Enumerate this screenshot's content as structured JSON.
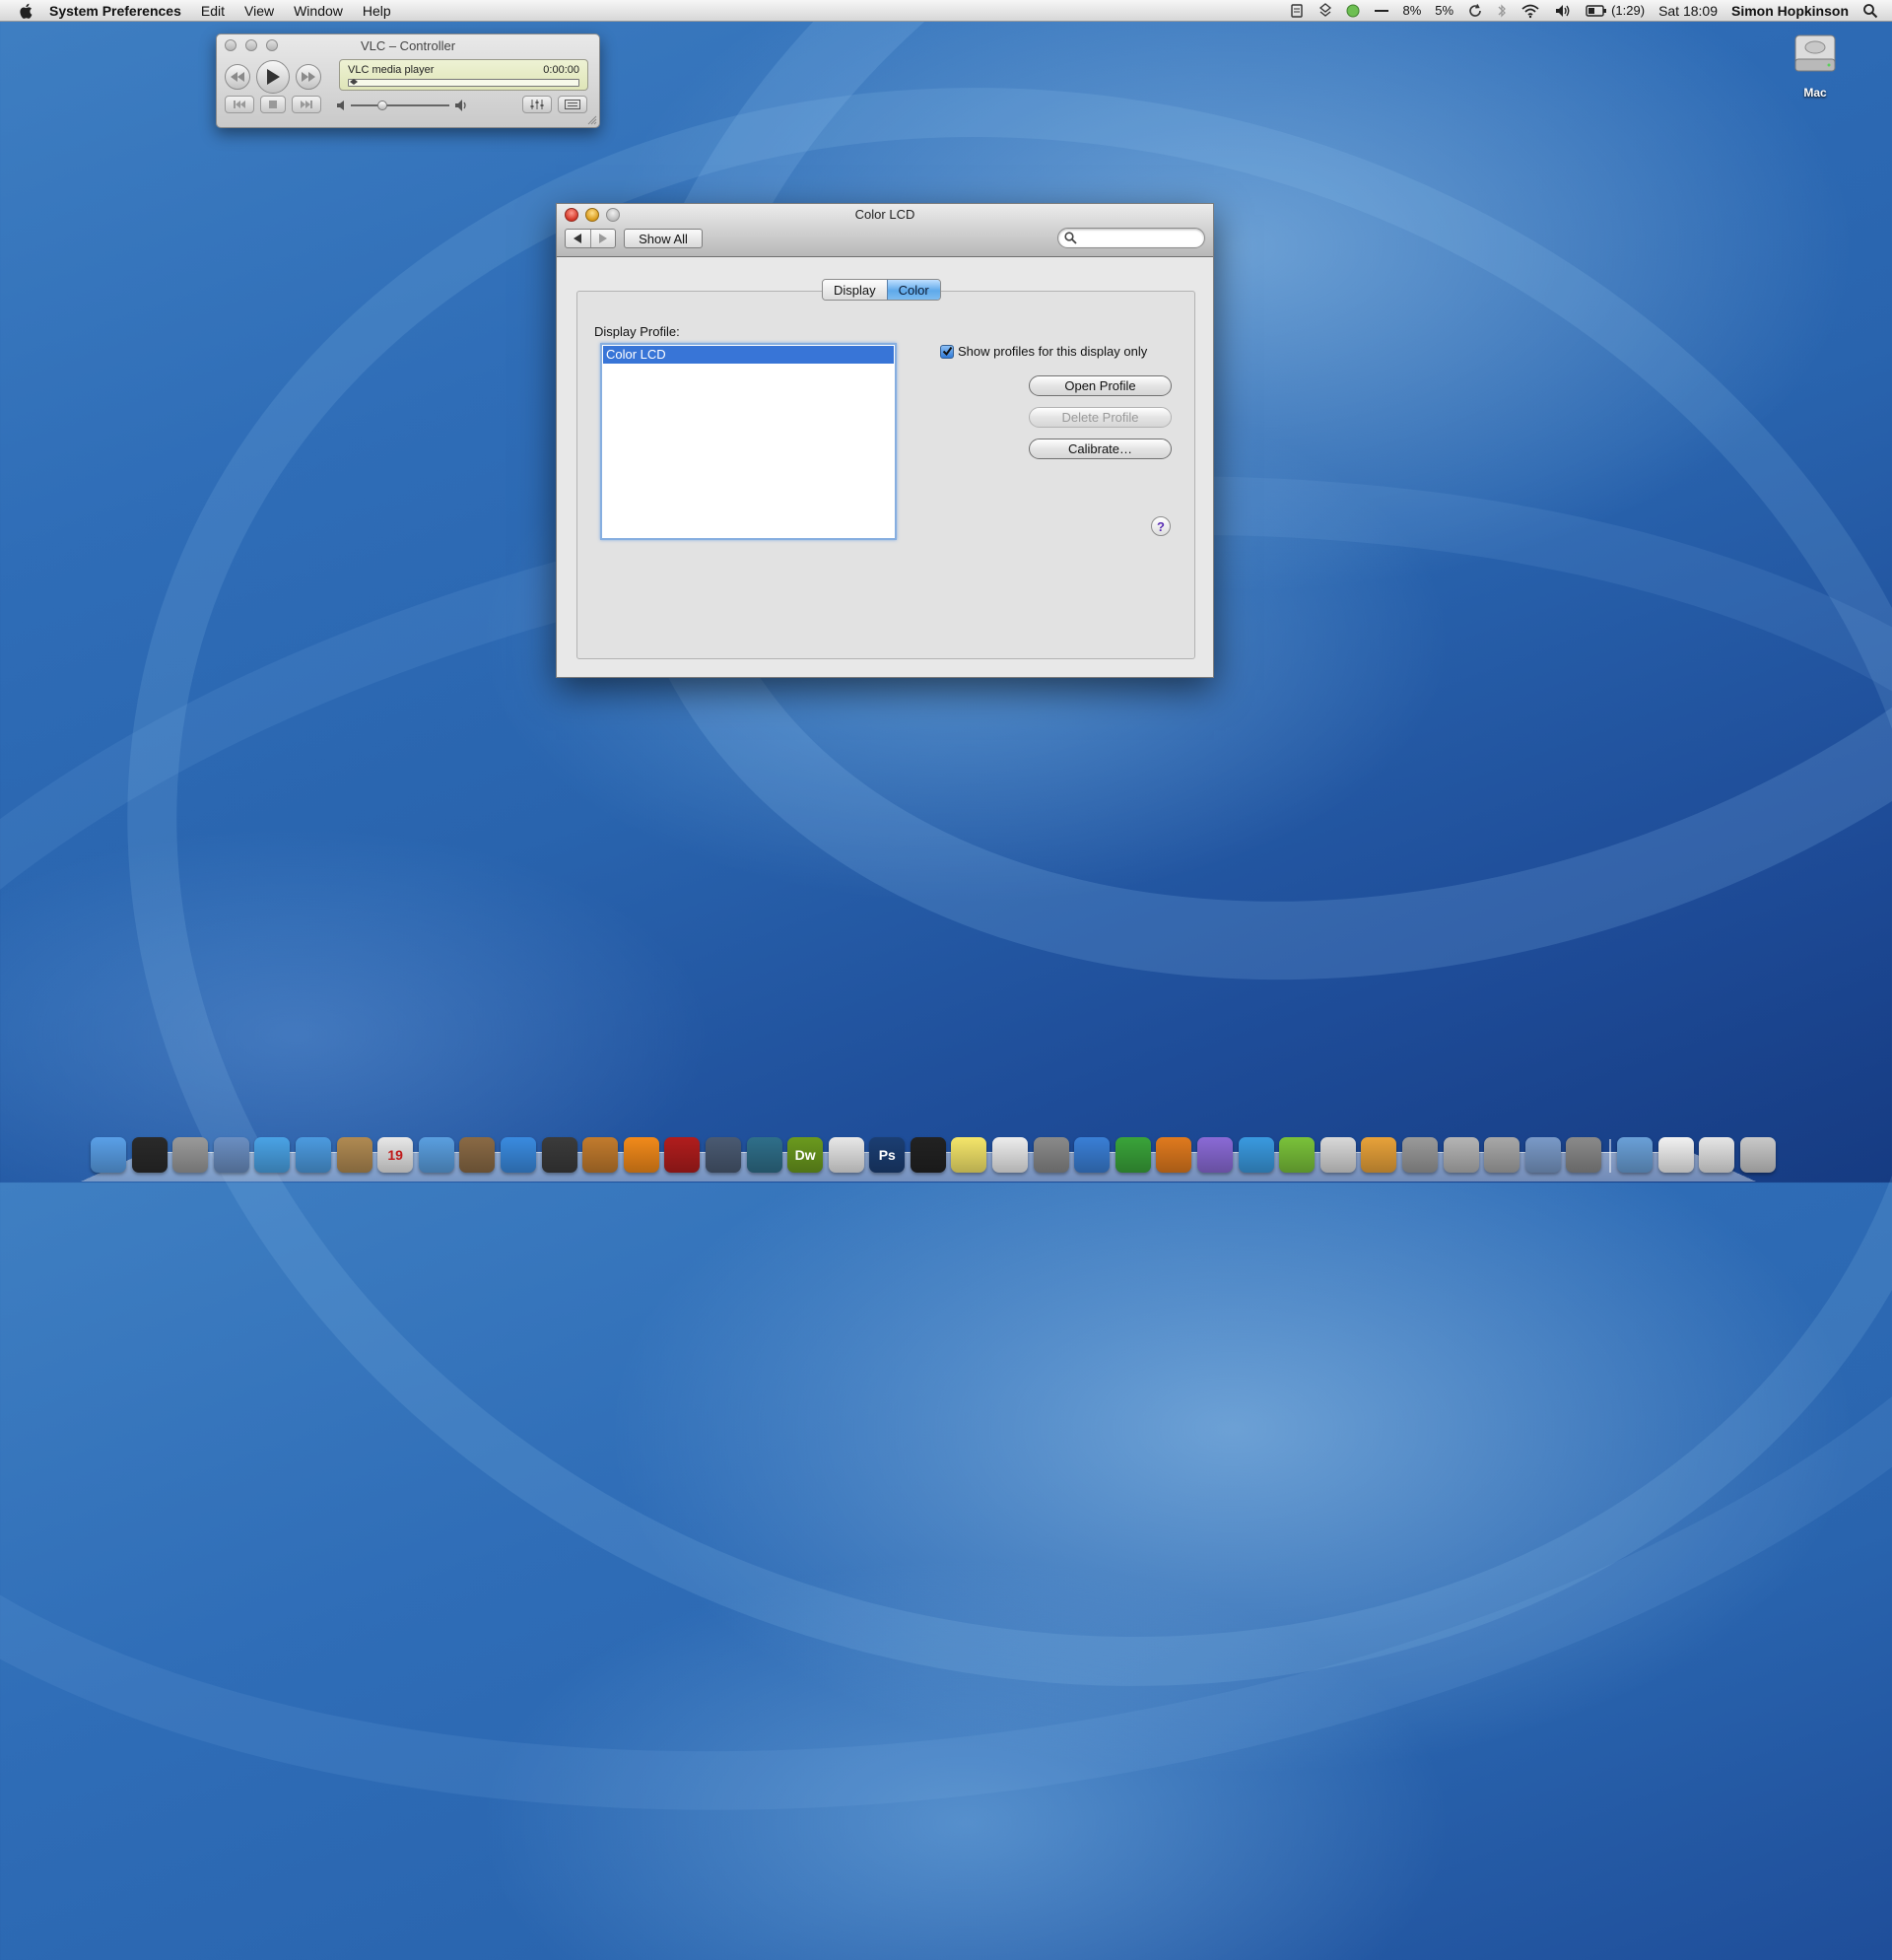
{
  "menubar": {
    "app_name": "System Preferences",
    "menus": [
      "Edit",
      "View",
      "Window",
      "Help"
    ],
    "status": {
      "cpu1": "8%",
      "cpu2": "5%",
      "battery": "(1:29)",
      "clock": "Sat 18:09",
      "user": "Simon Hopkinson"
    }
  },
  "desktop": {
    "drive_label": "Mac"
  },
  "vlc": {
    "title": "VLC – Controller",
    "media_name": "VLC media player",
    "time": "0:00:00",
    "volume_level": 0.3
  },
  "prefs": {
    "title": "Color LCD",
    "show_all": "Show All",
    "tabs": [
      {
        "label": "Display",
        "active": false
      },
      {
        "label": "Color",
        "active": true
      }
    ],
    "display_profile_label": "Display Profile:",
    "profiles": [
      "Color LCD"
    ],
    "show_profiles_checkbox": {
      "label": "Show profiles for this display only",
      "checked": true
    },
    "buttons": {
      "open": "Open Profile",
      "delete": "Delete Profile",
      "calibrate": "Calibrate…"
    },
    "help": "?"
  },
  "dock": {
    "items": [
      {
        "name": "finder-icon",
        "color": "#5aa0e8"
      },
      {
        "name": "dashboard-icon",
        "color": "#2a2a2a"
      },
      {
        "name": "calculator-icon",
        "color": "#9a9a9a"
      },
      {
        "name": "mail-icon",
        "color": "#6b8fc2"
      },
      {
        "name": "safari-icon",
        "color": "#4aa3e6"
      },
      {
        "name": "ichat-icon",
        "color": "#4c9be0"
      },
      {
        "name": "address-book-icon",
        "color": "#b08a52"
      },
      {
        "name": "ical-icon",
        "color": "#e8e8e8",
        "label": "19"
      },
      {
        "name": "itunes-icon",
        "color": "#5a9fe0"
      },
      {
        "name": "iphoto-icon",
        "color": "#8a6a45"
      },
      {
        "name": "dvd-player-icon",
        "color": "#3a8be0"
      },
      {
        "name": "imovie-icon",
        "color": "#3b3b3b"
      },
      {
        "name": "garageband-icon",
        "color": "#c27b2d"
      },
      {
        "name": "vlc-icon",
        "color": "#f28a1a"
      },
      {
        "name": "photo-booth-icon",
        "color": "#b11d1d"
      },
      {
        "name": "spaces-icon",
        "color": "#4a5a72"
      },
      {
        "name": "time-machine-icon",
        "color": "#2f6f8a"
      },
      {
        "name": "dreamweaver-icon",
        "color": "#6b9a1e",
        "label": "Dw"
      },
      {
        "name": "acrobat-icon",
        "color": "#e8e8e8"
      },
      {
        "name": "photoshop-icon",
        "color": "#1b3e73",
        "label": "Ps"
      },
      {
        "name": "aperture-icon",
        "color": "#222222"
      },
      {
        "name": "stickies-icon",
        "color": "#f5e66a"
      },
      {
        "name": "textedit-icon",
        "color": "#ededed"
      },
      {
        "name": "automator-icon",
        "color": "#8a8a8a"
      },
      {
        "name": "word-icon",
        "color": "#3a7fd6"
      },
      {
        "name": "excel-icon",
        "color": "#3aa43a"
      },
      {
        "name": "powerpoint-icon",
        "color": "#e07a1e"
      },
      {
        "name": "entourage-icon",
        "color": "#8a6ad6"
      },
      {
        "name": "messenger-icon",
        "color": "#3a9ae0"
      },
      {
        "name": "xbox-icon",
        "color": "#7ac23a"
      },
      {
        "name": "numbers-icon",
        "color": "#d9d9d9"
      },
      {
        "name": "pages-icon",
        "color": "#e8a23a"
      },
      {
        "name": "script-editor-icon",
        "color": "#9a9a9a"
      },
      {
        "name": "archive-icon",
        "color": "#b5b5b5"
      },
      {
        "name": "installer-icon",
        "color": "#a8a8a8"
      },
      {
        "name": "usb-icon",
        "color": "#7a9ac8"
      },
      {
        "name": "system-preferences-icon",
        "color": "#8a8a8a"
      }
    ],
    "right_items": [
      {
        "name": "applications-folder-icon",
        "color": "#6aa0d8"
      },
      {
        "name": "documents-icon",
        "color": "#f2f2f2"
      },
      {
        "name": "downloads-stack-icon",
        "color": "#e6e6e6"
      },
      {
        "name": "trash-icon",
        "color": "#c9c9c9"
      }
    ]
  }
}
